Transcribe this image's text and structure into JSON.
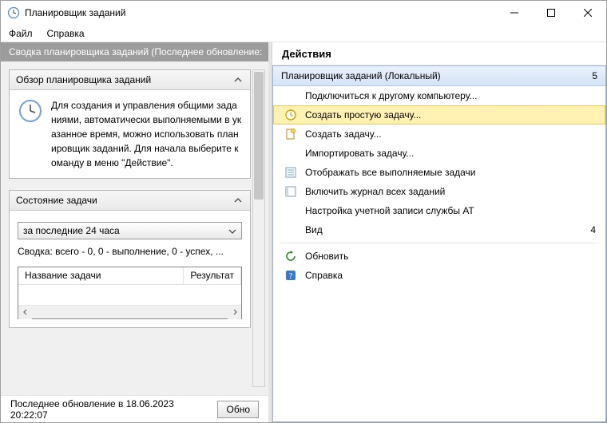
{
  "window": {
    "title": "Планировщик заданий"
  },
  "menu": {
    "file": "Файл",
    "help": "Справка"
  },
  "summary": {
    "header": "Сводка планировщика заданий (Последнее обновление:",
    "overview_title": "Обзор планировщика заданий",
    "overview_text": "Для создания и управления общими заданиями, автоматически выполняемыми в указанное время, можно использовать планировщик заданий. Для начала выберите команду в меню \"Действие\".",
    "status_title": "Состояние задачи",
    "dropdown_value": "за последние 24 часа",
    "stats_text": "Сводка: всего - 0, 0 - выполнение, 0 - успех, ...",
    "col_name": "Название задачи",
    "col_result": "Результат"
  },
  "status": {
    "last_update": "Последнее обновление в 18.06.2023 20:22:07",
    "refresh_button": "Обно"
  },
  "actions": {
    "title": "Действия",
    "header_label": "Планировщик заданий (Локальный)",
    "header_number": "5",
    "items": [
      {
        "label": "Подключиться к другому компьютеру...",
        "icon": "none"
      },
      {
        "label": "Создать простую задачу...",
        "icon": "clock",
        "selected": true
      },
      {
        "label": "Создать задачу...",
        "icon": "doc"
      },
      {
        "label": "Импортировать задачу...",
        "icon": "none"
      },
      {
        "label": "Отображать все выполняемые задачи",
        "icon": "list"
      },
      {
        "label": "Включить журнал всех заданий",
        "icon": "log"
      },
      {
        "label": "Настройка учетной записи службы AT",
        "icon": "none"
      }
    ],
    "view_label": "Вид",
    "view_number": "4",
    "refresh_label": "Обновить",
    "help_label": "Справка"
  }
}
